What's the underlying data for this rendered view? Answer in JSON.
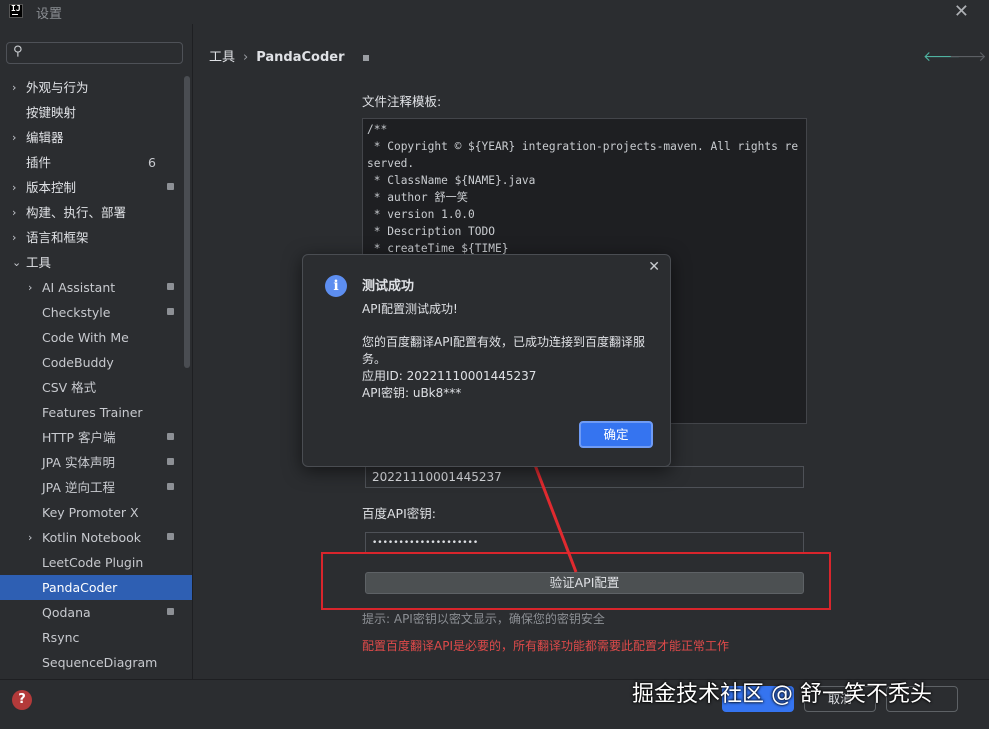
{
  "window": {
    "title": "设置",
    "logo": "IJ",
    "close_icon": "close-icon"
  },
  "search": {
    "placeholder": "",
    "icon": "search-icon"
  },
  "sidebar": {
    "items": [
      {
        "label": "外观与行为",
        "arrow": "›",
        "level": 0
      },
      {
        "label": "按键映射",
        "level": 0
      },
      {
        "label": "编辑器",
        "arrow": "›",
        "level": 0
      },
      {
        "label": "插件",
        "count": "6",
        "level": 0
      },
      {
        "label": "版本控制",
        "arrow": "›",
        "level": 0,
        "mark": true
      },
      {
        "label": "构建、执行、部署",
        "arrow": "›",
        "level": 0
      },
      {
        "label": "语言和框架",
        "arrow": "›",
        "level": 0
      },
      {
        "label": "工具",
        "arrow": "⌄",
        "level": 0
      },
      {
        "label": "AI Assistant",
        "arrow": "›",
        "level": 1,
        "mark": true
      },
      {
        "label": "Checkstyle",
        "level": 1,
        "mark": true
      },
      {
        "label": "Code With Me",
        "level": 1
      },
      {
        "label": "CodeBuddy",
        "level": 1
      },
      {
        "label": "CSV 格式",
        "level": 1
      },
      {
        "label": "Features Trainer",
        "level": 1
      },
      {
        "label": "HTTP 客户端",
        "level": 1,
        "mark": true
      },
      {
        "label": "JPA 实体声明",
        "level": 1,
        "mark": true
      },
      {
        "label": "JPA 逆向工程",
        "level": 1,
        "mark": true
      },
      {
        "label": "Key Promoter X",
        "level": 1
      },
      {
        "label": "Kotlin Notebook",
        "arrow": "›",
        "level": 1,
        "mark": true
      },
      {
        "label": "LeetCode Plugin",
        "level": 1
      },
      {
        "label": "PandaCoder",
        "level": 1,
        "selected": true
      },
      {
        "label": "Qodana",
        "level": 1,
        "mark": true
      },
      {
        "label": "Rsync",
        "level": 1
      },
      {
        "label": "SequenceDiagram",
        "level": 1
      }
    ]
  },
  "breadcrumb": {
    "root": "工具",
    "separator": "›",
    "leaf": "PandaCoder"
  },
  "nav": {
    "back": "🡐",
    "forward": "🡒"
  },
  "main": {
    "template_label": "文件注释模板:",
    "template_text": "/**\n * Copyright © ${YEAR} integration-projects-maven. All rights reserved.\n * ClassName ${NAME}.java\n * author 舒一笑\n * version 1.0.0\n * Description TODO\n * createTime ${TIME}",
    "app_id_value": "20221110001445237",
    "api_key_label": "百度API密钥:",
    "api_key_value": "••••••••••••••••••••",
    "verify_button": "验证API配置",
    "hint": "提示: API密钥以密文显示，确保您的密钥安全",
    "warning": "配置百度翻译API是必要的，所有翻译功能都需要此配置才能正常工作"
  },
  "dialog": {
    "title": "测试成功",
    "line1": "API配置测试成功!",
    "line2": "您的百度翻译API配置有效，已成功连接到百度翻译服",
    "line3": "务。",
    "line4": "应用ID: 20221110001445237",
    "line5": "API密钥: uBk8***",
    "ok": "确定",
    "close": "✕"
  },
  "footer": {
    "help": "?",
    "cancel": "取消"
  },
  "watermark": "掘金技术社区 @ 舒一笑不秃头",
  "colors": {
    "accent": "#3574f0",
    "selection": "#2e5fb3",
    "annotation_red": "#d9252c",
    "warning_text": "#e04a4a"
  }
}
